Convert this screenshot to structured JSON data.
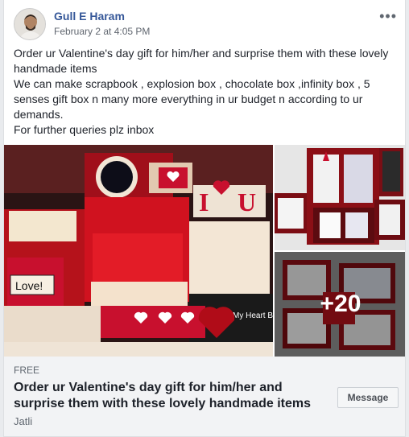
{
  "post": {
    "author": "Gull E Haram",
    "timestamp": "February 2 at 4:05 PM",
    "more_menu": "•••",
    "text_lines": [
      "Order ur Valentine's day gift for him/her and surprise them with these lovely handmade items",
      "We can make scrapbook , explosion box , chocolate box ,infinity box , 5 senses gift box n many more everything in ur budget n according to ur demands.",
      "For further queries plz inbox"
    ]
  },
  "gallery": {
    "more_count": "+20",
    "main_image_text": {
      "label1": "Love!",
      "label2": "I",
      "label3": "U",
      "label4": "My Heart Be"
    }
  },
  "listing": {
    "price": "FREE",
    "title": "Order ur Valentine's day gift for him/her and surprise them with these lovely handmade items",
    "location": "Jatli",
    "message_button": "Message"
  },
  "colors": {
    "link": "#365899",
    "primary_text": "#1d2129",
    "secondary_text": "#606770",
    "accent_red": "#c8102e"
  }
}
